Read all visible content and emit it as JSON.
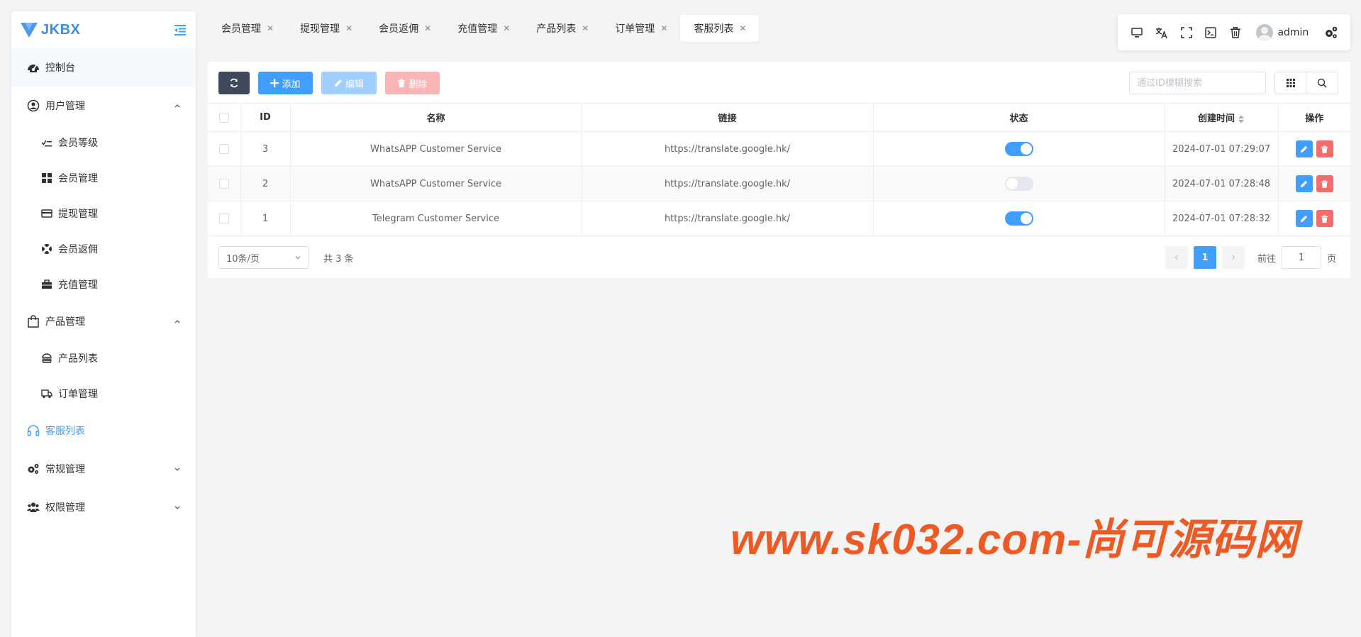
{
  "brand": {
    "title": "JKBX"
  },
  "sidebar": {
    "items": [
      {
        "label": "控制台",
        "icon": "dashboard-icon"
      },
      {
        "label": "用户管理",
        "icon": "user-circle-icon",
        "children": [
          {
            "label": "会员等级",
            "icon": "list-check-icon"
          },
          {
            "label": "会员管理",
            "icon": "grid-icon"
          },
          {
            "label": "提现管理",
            "icon": "credit-card-icon"
          },
          {
            "label": "会员返佣",
            "icon": "life-ring-icon"
          },
          {
            "label": "充值管理",
            "icon": "briefcase-icon"
          }
        ]
      },
      {
        "label": "产品管理",
        "icon": "shopping-bag-icon",
        "children": [
          {
            "label": "产品列表",
            "icon": "hamburger-icon"
          },
          {
            "label": "订单管理",
            "icon": "truck-icon"
          }
        ]
      },
      {
        "label": "客服列表",
        "icon": "headset-icon"
      },
      {
        "label": "常规管理",
        "icon": "cogs-icon"
      },
      {
        "label": "权限管理",
        "icon": "users-icon"
      }
    ]
  },
  "tabs": [
    {
      "label": "会员管理"
    },
    {
      "label": "提现管理"
    },
    {
      "label": "会员返佣"
    },
    {
      "label": "充值管理"
    },
    {
      "label": "产品列表"
    },
    {
      "label": "订单管理"
    },
    {
      "label": "客服列表"
    }
  ],
  "header": {
    "user_name": "admin"
  },
  "toolbar": {
    "add_label": "添加",
    "edit_label": "编辑",
    "delete_label": "删除",
    "search_placeholder": "通过ID模糊搜索"
  },
  "table": {
    "columns": [
      "ID",
      "名称",
      "链接",
      "状态",
      "创建时间",
      "操作"
    ],
    "rows": [
      {
        "id": "3",
        "name": "WhatsAPP Customer Service",
        "link": "https://translate.google.hk/",
        "status": true,
        "created": "2024-07-01 07:29:07"
      },
      {
        "id": "2",
        "name": "WhatsAPP Customer Service",
        "link": "https://translate.google.hk/",
        "status": false,
        "created": "2024-07-01 07:28:48"
      },
      {
        "id": "1",
        "name": "Telegram Customer Service",
        "link": "https://translate.google.hk/",
        "status": true,
        "created": "2024-07-01 07:28:32"
      }
    ]
  },
  "pagination": {
    "page_size": "10条/页",
    "total": "共 3 条",
    "current_page": "1",
    "goto_label": "前往",
    "goto_value": "1",
    "page_suffix": "页"
  },
  "watermark": "www.sk032.com-尚可源码网",
  "colors": {
    "primary": "#409eff",
    "danger": "#f56c6c",
    "dark": "#3e4a5c",
    "watermark": "#ee5a24"
  }
}
